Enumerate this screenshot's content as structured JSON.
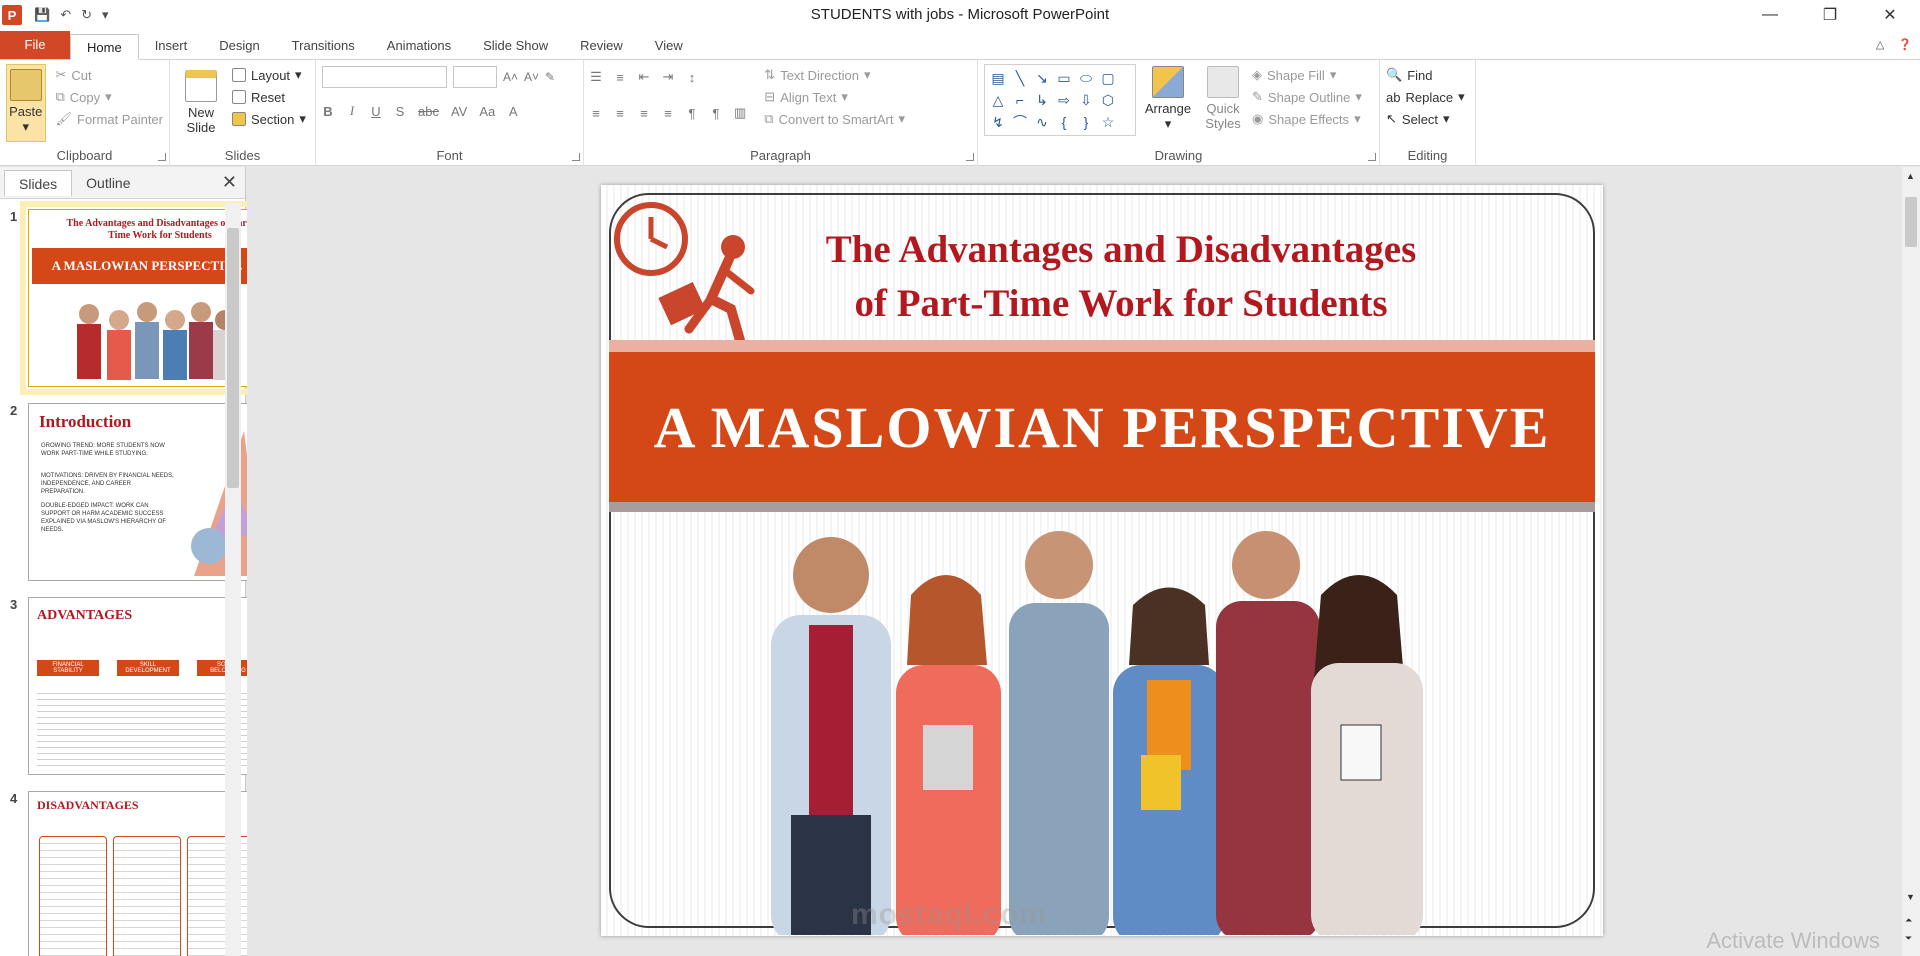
{
  "window": {
    "title": "STUDENTS with jobs  -  Microsoft PowerPoint",
    "app_icon_letter": "P",
    "controls": {
      "minimize": "—",
      "restore": "❐",
      "close": "✕"
    }
  },
  "tabs": [
    "File",
    "Home",
    "Insert",
    "Design",
    "Transitions",
    "Animations",
    "Slide Show",
    "Review",
    "View"
  ],
  "ribbon": {
    "clipboard": {
      "label": "Clipboard",
      "paste": "Paste",
      "cut": "Cut",
      "copy": "Copy",
      "format_painter": "Format Painter"
    },
    "slides": {
      "label": "Slides",
      "new_slide_line1": "New",
      "new_slide_line2": "Slide",
      "layout": "Layout",
      "reset": "Reset",
      "section": "Section"
    },
    "font": {
      "label": "Font"
    },
    "paragraph": {
      "label": "Paragraph",
      "text_direction": "Text Direction",
      "align_text": "Align Text",
      "convert_smartart": "Convert to SmartArt"
    },
    "drawing": {
      "label": "Drawing",
      "arrange": "Arrange",
      "quick_styles_line1": "Quick",
      "quick_styles_line2": "Styles",
      "shape_fill": "Shape Fill",
      "shape_outline": "Shape Outline",
      "shape_effects": "Shape Effects"
    },
    "editing": {
      "label": "Editing",
      "find": "Find",
      "replace": "Replace",
      "select": "Select"
    }
  },
  "panel": {
    "tab_slides": "Slides",
    "tab_outline": "Outline",
    "thumbnails": [
      {
        "num": "1",
        "title": "The Advantages and Disadvantages of Part-Time Work for Students",
        "band": "A MASLOWIAN PERSPECTIVE"
      },
      {
        "num": "2",
        "title": "Introduction",
        "bullets": [
          "GROWING TREND: MORE STUDENTS NOW WORK PART-TIME WHILE STUDYING.",
          "MOTIVATIONS: DRIVEN BY FINANCIAL NEEDS, INDEPENDENCE, AND CAREER PREPARATION.",
          "DOUBLE-EDGED IMPACT: WORK CAN SUPPORT OR HARM ACADEMIC SUCCESS EXPLAINED VIA MASLOW'S HIERARCHY OF NEEDS."
        ]
      },
      {
        "num": "3",
        "title": "ADVANTAGES",
        "cols": [
          "FINANCIAL STABILITY",
          "SKILL DEVELOPMENT",
          "SOCIAL BELONGING"
        ]
      },
      {
        "num": "4",
        "title": "DISADVANTAGES"
      }
    ]
  },
  "slide": {
    "title_line1": "The Advantages and Disadvantages",
    "title_line2": "of Part-Time Work for Students",
    "band_text": "A MASLOWIAN PERSPECTIVE",
    "watermark": "mostaql.com"
  },
  "status": {
    "activate": "Activate Windows"
  }
}
